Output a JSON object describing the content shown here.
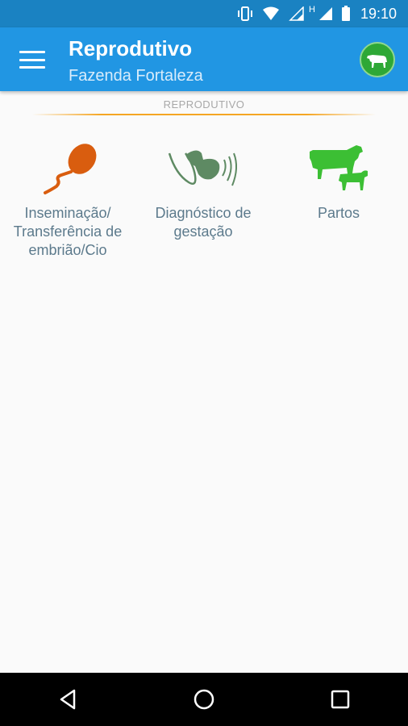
{
  "status_bar": {
    "time": "19:10",
    "network_label": "H",
    "icons": [
      "vibrate-icon",
      "wifi-icon",
      "signal-icon",
      "signal-icon",
      "battery-icon"
    ]
  },
  "app_bar": {
    "title": "Reprodutivo",
    "subtitle": "Fazenda Fortaleza",
    "menu_icon": "hamburger-menu-icon",
    "action_icon": "cow-icon"
  },
  "section": {
    "header": "REPRODUTIVO"
  },
  "menu_items": [
    {
      "label": "Inseminação/\nTransferência de\nembrião/Cio",
      "icon": "sperm-icon",
      "color": "#d95d0f"
    },
    {
      "label": "Diagnóstico de\ngestação",
      "icon": "ultrasound-icon",
      "color": "#5e8a63"
    },
    {
      "label": "Partos",
      "icon": "cow-calf-icon",
      "color": "#3cbf34"
    }
  ],
  "nav_bar": {
    "icons": [
      "back-icon",
      "home-icon",
      "recents-icon"
    ]
  },
  "colors": {
    "status_bar": "#1a82c2",
    "app_bar": "#2196e3",
    "accent_line": "#f5a623",
    "label_text": "#5c7a8c"
  }
}
